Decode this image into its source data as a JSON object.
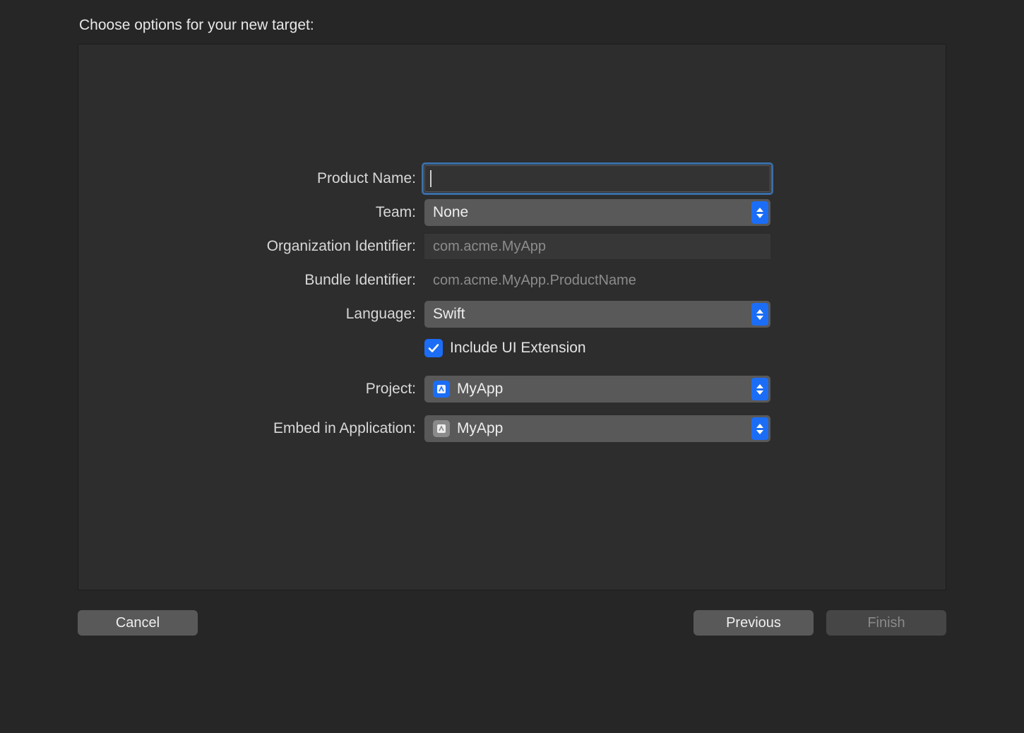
{
  "dialog": {
    "title": "Choose options for your new target:"
  },
  "form": {
    "product_name_label": "Product Name:",
    "product_name_value": "",
    "team_label": "Team:",
    "team_value": "None",
    "org_id_label": "Organization Identifier:",
    "org_id_value": "com.acme.MyApp",
    "bundle_id_label": "Bundle Identifier:",
    "bundle_id_value": "com.acme.MyApp.ProductName",
    "language_label": "Language:",
    "language_value": "Swift",
    "include_ui_ext_label": "Include UI Extension",
    "include_ui_ext_checked": true,
    "project_label": "Project:",
    "project_value": "MyApp",
    "embed_label": "Embed in Application:",
    "embed_value": "MyApp"
  },
  "buttons": {
    "cancel": "Cancel",
    "previous": "Previous",
    "finish": "Finish"
  }
}
